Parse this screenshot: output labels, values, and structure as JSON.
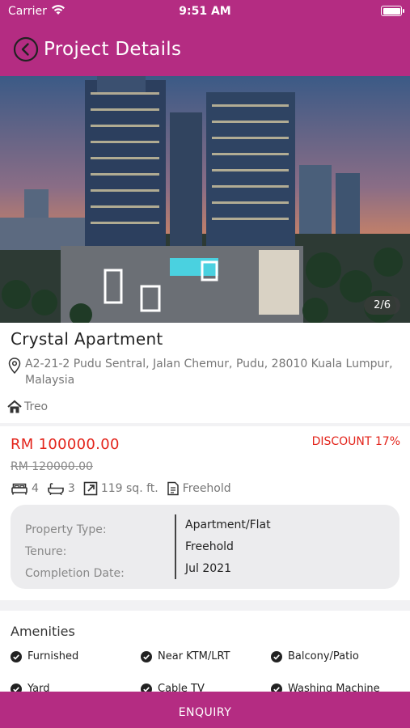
{
  "status_bar": {
    "carrier": "Carrier",
    "time": "9:51 AM"
  },
  "nav": {
    "title": "Project Details",
    "back_icon": "chevron-left-circle-icon"
  },
  "gallery": {
    "counter": "2/6"
  },
  "project": {
    "name": "Crystal Apartment",
    "address": "A2-21-2 Pudu Sentral, Jalan Chemur, Pudu, 28010 Kuala Lumpur, Malaysia",
    "developer": "Treo"
  },
  "pricing": {
    "price": "RM 100000.00",
    "discount": "DISCOUNT 17%",
    "original_price": "RM 120000.00"
  },
  "specs": {
    "bedrooms": "4",
    "bathrooms": "3",
    "area": "119 sq. ft.",
    "tenure": "Freehold"
  },
  "details": {
    "labels": [
      "Property Type:",
      "Tenure:",
      "Completion Date:"
    ],
    "values": [
      "Apartment/Flat",
      "Freehold",
      "Jul 2021"
    ]
  },
  "amenities": {
    "title": "Amenities",
    "items": [
      "Furnished",
      "Near KTM/LRT",
      "Balcony/Patio",
      "Yard",
      "Cable TV",
      "Washing Machine"
    ]
  },
  "footer": {
    "enquiry_label": "ENQUIRY"
  },
  "colors": {
    "brand": "#b42c82",
    "price_red": "#e3241b"
  }
}
